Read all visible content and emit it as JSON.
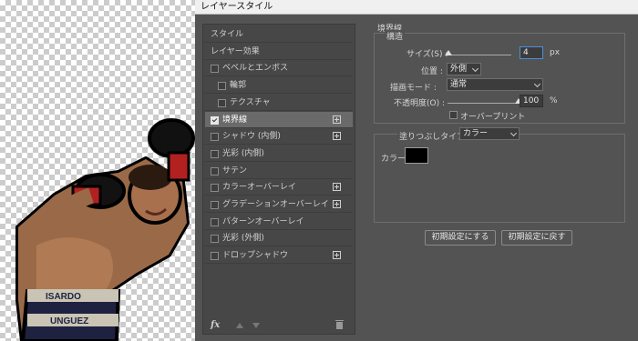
{
  "window": {
    "title": "レイヤースタイル"
  },
  "left_panel": {
    "items": [
      {
        "label": "スタイル",
        "checkbox": false,
        "checked": false,
        "plus": false,
        "selected": false
      },
      {
        "label": "レイヤー効果",
        "checkbox": false,
        "checked": false,
        "plus": false,
        "selected": false
      },
      {
        "label": "ベベルとエンボス",
        "checkbox": true,
        "checked": false,
        "plus": false,
        "selected": false
      },
      {
        "label": "輪郭",
        "checkbox": true,
        "checked": false,
        "plus": false,
        "selected": false,
        "indent": true
      },
      {
        "label": "テクスチャ",
        "checkbox": true,
        "checked": false,
        "plus": false,
        "selected": false,
        "indent": true
      },
      {
        "label": "境界線",
        "checkbox": true,
        "checked": true,
        "plus": true,
        "selected": true
      },
      {
        "label": "シャドウ (内側)",
        "checkbox": true,
        "checked": false,
        "plus": true,
        "selected": false
      },
      {
        "label": "光彩 (内側)",
        "checkbox": true,
        "checked": false,
        "plus": false,
        "selected": false
      },
      {
        "label": "サテン",
        "checkbox": true,
        "checked": false,
        "plus": false,
        "selected": false
      },
      {
        "label": "カラーオーバーレイ",
        "checkbox": true,
        "checked": false,
        "plus": true,
        "selected": false
      },
      {
        "label": "グラデーションオーバーレイ",
        "checkbox": true,
        "checked": false,
        "plus": true,
        "selected": false
      },
      {
        "label": "パターンオーバーレイ",
        "checkbox": true,
        "checked": false,
        "plus": false,
        "selected": false
      },
      {
        "label": "光彩 (外側)",
        "checkbox": true,
        "checked": false,
        "plus": false,
        "selected": false
      },
      {
        "label": "ドロップシャドウ",
        "checkbox": true,
        "checked": false,
        "plus": true,
        "selected": false
      }
    ],
    "fx_label": "fx"
  },
  "stroke": {
    "section_title": "境界線",
    "structure_title": "構造",
    "size_label": "サイズ(S) :",
    "size_value": "4",
    "size_unit": "px",
    "position_label": "位置 :",
    "position_value": "外側",
    "blend_label": "描画モード :",
    "blend_value": "通常",
    "opacity_label": "不透明度(O) :",
    "opacity_value": "100",
    "opacity_unit": "%",
    "overprint_label": "オーバープリント",
    "overprint_checked": false,
    "fill_type_label": "塗りつぶしタイプ :",
    "fill_type_value": "カラー",
    "color_label": "カラー :",
    "color_value": "#000000",
    "size_fraction": 0.02,
    "opacity_fraction": 1.0
  },
  "buttons": {
    "set_default": "初期設定にする",
    "reset_default": "初期設定に戻す"
  }
}
